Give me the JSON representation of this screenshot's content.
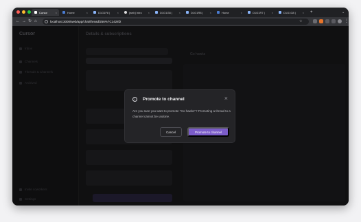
{
  "browser": {
    "tabs": [
      {
        "label": "Cursor",
        "active": true
      },
      {
        "label": "Home"
      },
      {
        "label": "D1G1F8 |"
      },
      {
        "label": "[web] Intro"
      },
      {
        "label": "D1G1G8 |"
      },
      {
        "label": "D1G1R8 |"
      },
      {
        "label": "Home"
      },
      {
        "label": "D1G1R7 |"
      },
      {
        "label": "D1G1G8 |"
      }
    ],
    "url": "localhost:3000/web/app/chat/thread/256%7C1428f2"
  },
  "background": {
    "brand": "Cursor",
    "sidebar_items": [
      "Inbox",
      "Channels",
      "Threads & Channels",
      "Archived",
      "Invite coworkers",
      "Settings"
    ],
    "channel_title": "Details & subscriptions",
    "thread_panel_title": "Go hawks"
  },
  "modal": {
    "title": "Promote to channel",
    "body": "Are you sure you want to promote \"Go hawks\"? Promoting a thread to a channel cannot be undone.",
    "cancel_label": "Cancel",
    "confirm_label": "Promote to channel",
    "accent": "#7b5cc9"
  }
}
